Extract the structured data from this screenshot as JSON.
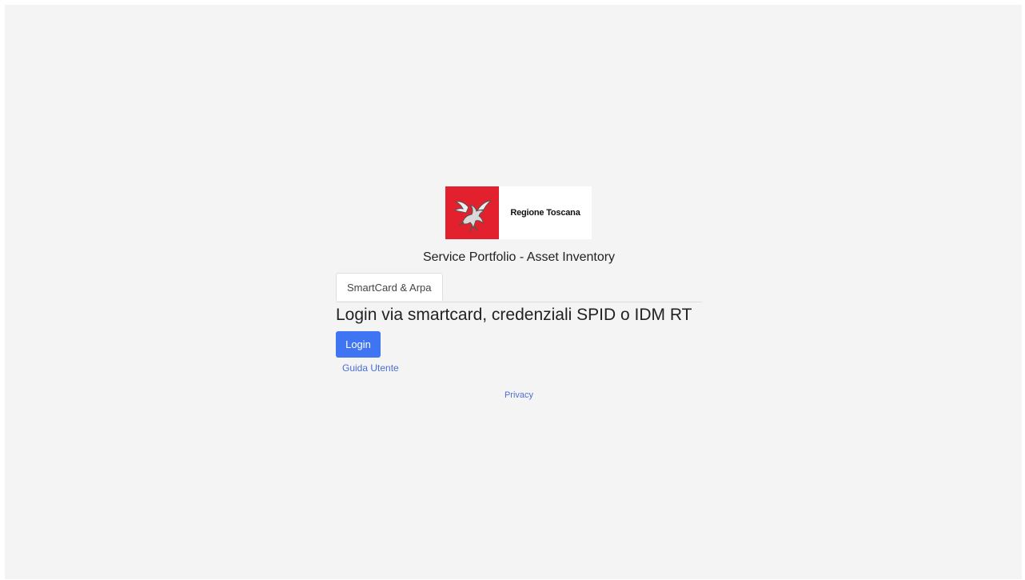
{
  "logo": {
    "text": "Regione Toscana",
    "icon": "pegasus-icon",
    "brand_color": "#e3202d"
  },
  "title": "Service Portfolio - Asset Inventory",
  "tabs": [
    {
      "label": "SmartCard & Arpa",
      "active": true
    }
  ],
  "heading": "Login via smartcard, credenziali SPID o IDM RT",
  "login_button": {
    "label": "Login",
    "color": "#3f75f2"
  },
  "links": {
    "guide": "Guida Utente",
    "privacy": "Privacy"
  }
}
